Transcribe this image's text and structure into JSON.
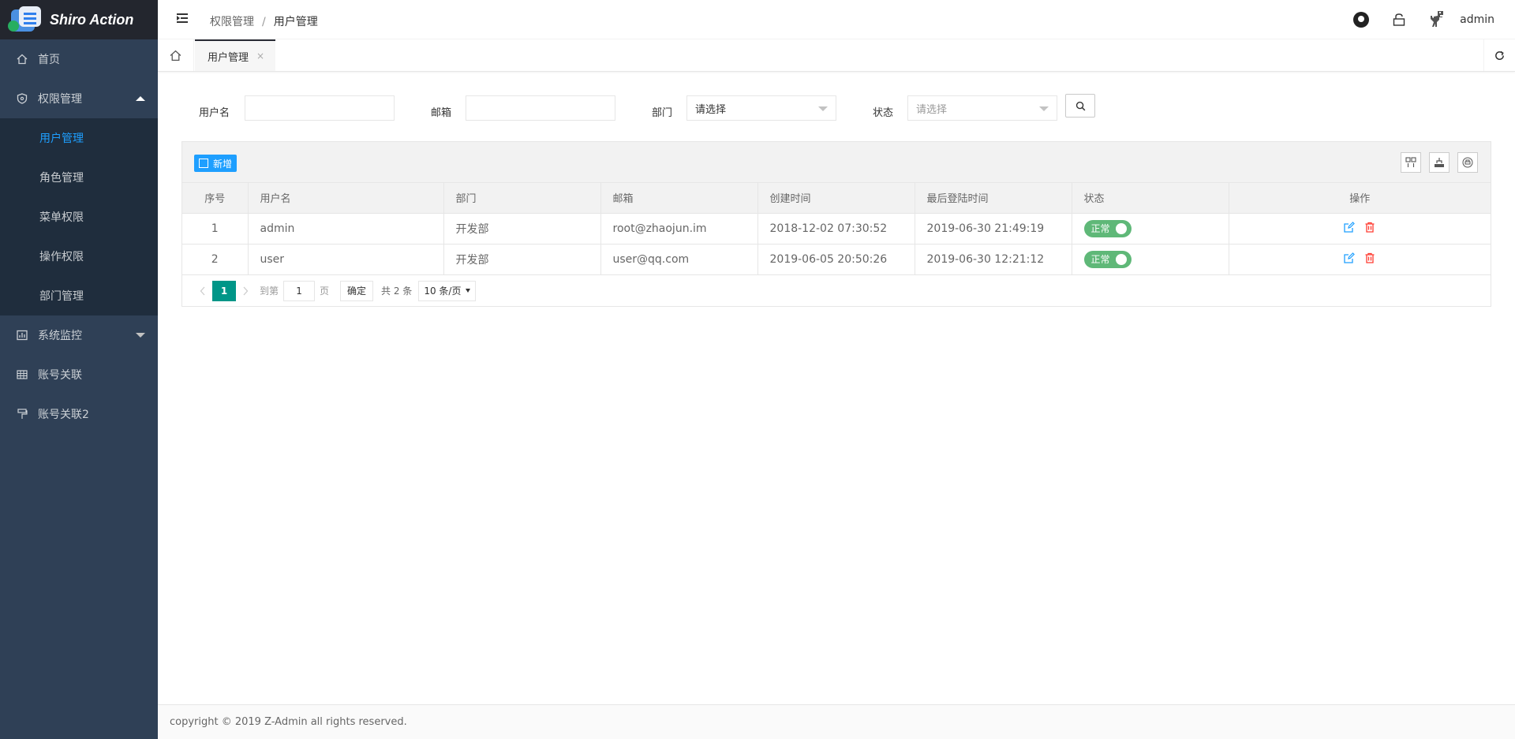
{
  "app": {
    "title": "Shiro Action"
  },
  "sidebar": {
    "items": [
      {
        "label": "首页",
        "icon": "home-icon"
      },
      {
        "label": "权限管理",
        "icon": "shield-icon",
        "expanded": true,
        "children": [
          "用户管理",
          "角色管理",
          "菜单权限",
          "操作权限",
          "部门管理"
        ],
        "active_child": "用户管理"
      },
      {
        "label": "系统监控",
        "icon": "monitor-icon",
        "expanded": false
      },
      {
        "label": "账号关联",
        "icon": "table-icon"
      },
      {
        "label": "账号关联2",
        "icon": "brush-icon"
      }
    ]
  },
  "header": {
    "breadcrumb": [
      "权限管理",
      "用户管理"
    ],
    "user": "admin"
  },
  "tabs": [
    {
      "label": "用户管理",
      "close": "×"
    }
  ],
  "search": {
    "username_label": "用户名",
    "email_label": "邮箱",
    "dept_label": "部门",
    "dept_placeholder": "请选择",
    "status_label": "状态",
    "status_placeholder": "请选择"
  },
  "toolbar": {
    "add_label": "新增"
  },
  "table": {
    "columns": [
      "序号",
      "用户名",
      "部门",
      "邮箱",
      "创建时间",
      "最后登陆时间",
      "状态",
      "操作"
    ],
    "rows": [
      {
        "index": "1",
        "username": "admin",
        "dept": "开发部",
        "email": "root@zhaojun.im",
        "created": "2018-12-02 07:30:52",
        "last_login": "2019-06-30 21:49:19",
        "status": "正常"
      },
      {
        "index": "2",
        "username": "user",
        "dept": "开发部",
        "email": "user@qq.com",
        "created": "2019-06-05 20:50:26",
        "last_login": "2019-06-30 12:21:12",
        "status": "正常"
      }
    ]
  },
  "pager": {
    "current": "1",
    "goto_label": "到第",
    "goto_value": "1",
    "page_label": "页",
    "confirm_label": "确定",
    "total": "共 2 条",
    "page_size": "10 条/页"
  },
  "footer": {
    "text": "copyright © 2019 Z-Admin all rights reserved."
  },
  "colors": {
    "sidebar_bg": "#2f4056",
    "accent": "#1e9fff",
    "pager_active": "#009688",
    "switch_on": "#5fb878",
    "delete_red": "#ff5722"
  }
}
